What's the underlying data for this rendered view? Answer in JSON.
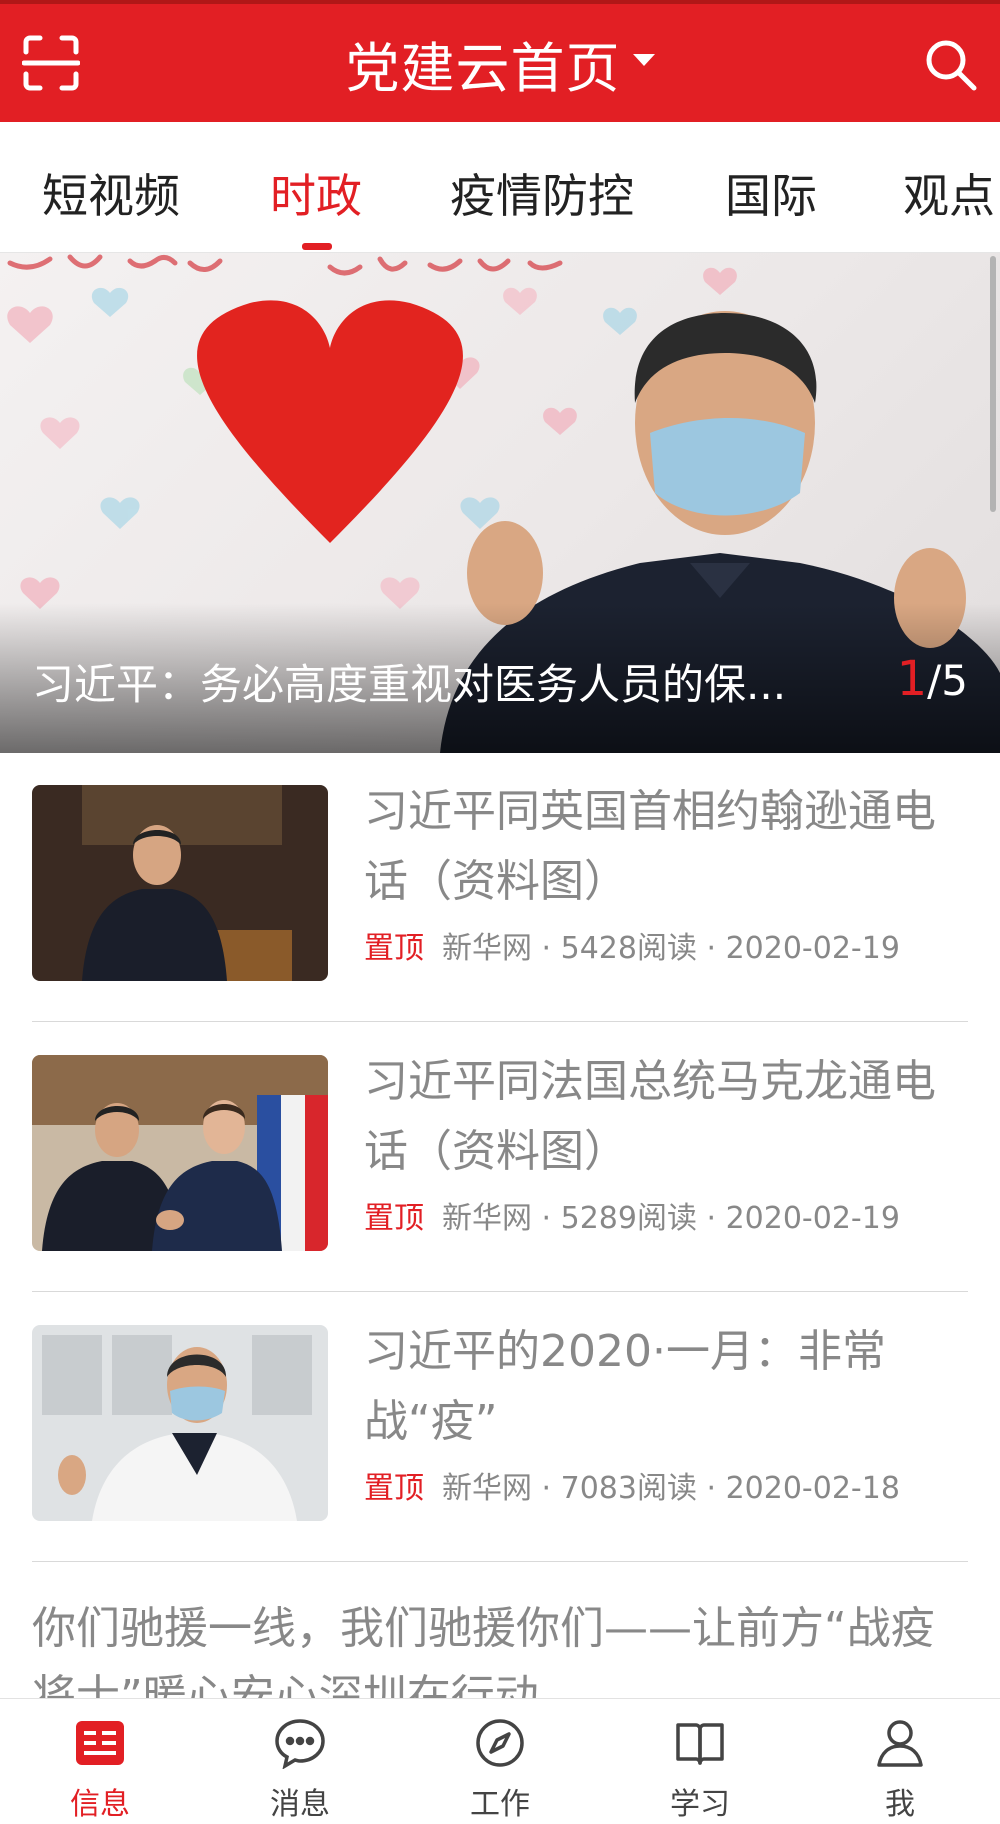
{
  "header": {
    "title": "党建云首页",
    "accent_color": "#e21f24",
    "left_icon": "scan-icon",
    "right_icon": "search-icon"
  },
  "tabs": [
    {
      "label": "短视频",
      "active": false
    },
    {
      "label": "时政",
      "active": true
    },
    {
      "label": "疫情防控",
      "active": false
    },
    {
      "label": "国际",
      "active": false
    },
    {
      "label": "观点",
      "active": false
    }
  ],
  "banner": {
    "caption": "习近平：务必高度重视对医务人员的保...",
    "current_index": "1",
    "total": "/5"
  },
  "news": [
    {
      "title": "习近平同英国首相约翰逊通电话（资料图）",
      "pin": "置顶",
      "source": "新华网",
      "reads": "5428阅读",
      "date": "2020-02-19"
    },
    {
      "title": "习近平同法国总统马克龙通电话（资料图）",
      "pin": "置顶",
      "source": "新华网",
      "reads": "5289阅读",
      "date": "2020-02-19"
    },
    {
      "title": "习近平的2020·一月：非常战“疫”",
      "pin": "置顶",
      "source": "新华网",
      "reads": "7083阅读",
      "date": "2020-02-18"
    }
  ],
  "partial_news_title": "你们驰援一线，我们驰援你们——让前方“战疫将士”暖心安心深圳在行动",
  "bottom_nav": [
    {
      "label": "信息",
      "icon": "news-icon",
      "active": true
    },
    {
      "label": "消息",
      "icon": "chat-bubble-icon",
      "active": false
    },
    {
      "label": "工作",
      "icon": "compass-icon",
      "active": false
    },
    {
      "label": "学习",
      "icon": "book-icon",
      "active": false
    },
    {
      "label": "我",
      "icon": "person-icon",
      "active": false
    }
  ]
}
